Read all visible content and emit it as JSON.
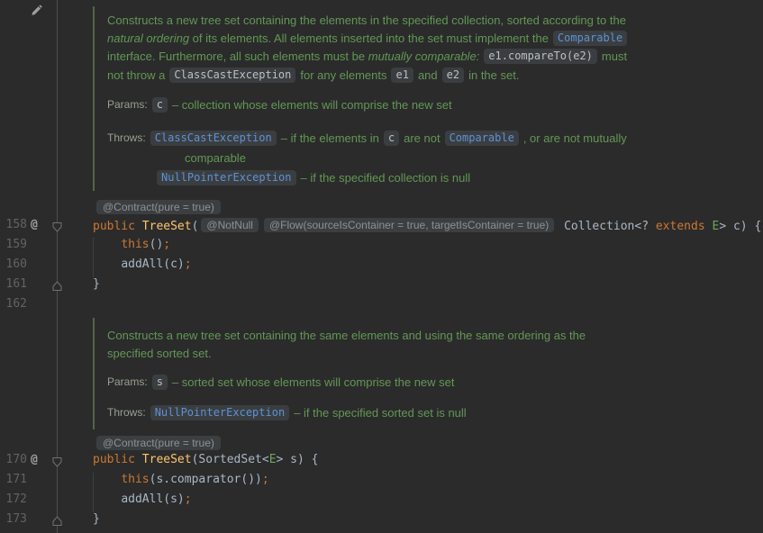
{
  "gutter": {
    "numbers": [
      "158",
      "159",
      "160",
      "161",
      "162",
      "170",
      "171",
      "172",
      "173"
    ],
    "annotation_symbol": "@"
  },
  "doc1": {
    "l1": "Constructs a new tree set containing the elements in the specified collection, sorted according to the",
    "l2_italic": "natural ordering",
    "l2_text": " of its elements. All elements inserted into the set must implement the",
    "l2_chip_link": "Comparable",
    "l3_text1": "interface. Furthermore, all such elements must be ",
    "l3_italic": "mutually comparable:",
    "l3_chip": "e1.compareTo(e2)",
    "l3_text2": "must",
    "l4_text1": "not throw a",
    "l4_chip1": "ClassCastException",
    "l4_text2": "for any elements",
    "l4_chip2": "e1",
    "l4_text3": "and",
    "l4_chip3": "e2",
    "l4_text4": "in the set.",
    "params_label": "Params:",
    "params_chip": "c",
    "params_text": "– collection whose elements will comprise the new set",
    "throws_label": "Throws:",
    "throws_chip1": "ClassCastException",
    "throws_text1": "– if the elements in",
    "throws_chip2": "c",
    "throws_text2": "are not",
    "throws_chip3": "Comparable",
    "throws_text3": ", or are not mutually",
    "throws_wrap": "comparable",
    "throws_chip4": "NullPointerException",
    "throws_text4": "– if the specified collection is null"
  },
  "code1": {
    "inlay_contract": "@Contract(pure = true)",
    "l158": {
      "kw1": "public ",
      "name": "TreeSet",
      "paren": "(",
      "inlay_notnull": "@NotNull",
      "inlay_flow": "@Flow(sourceIsContainer = true, targetIsContainer = true)",
      "t1": " Collection<? ",
      "kw2": "extends",
      "tp": " E",
      "t2": "> c) {"
    },
    "l159": {
      "indent": "    ",
      "kw": "this",
      "t": "()",
      "semi": ";"
    },
    "l160": {
      "indent": "    ",
      "t": "addAll(c)",
      "semi": ";"
    },
    "l161": {
      "t": "}"
    }
  },
  "doc2": {
    "l1": "Constructs a new tree set containing the same elements and using the same ordering as the",
    "l2": "specified sorted set.",
    "params_label": "Params:",
    "params_chip": "s",
    "params_text": "– sorted set whose elements will comprise the new set",
    "throws_label": "Throws:",
    "throws_chip": "NullPointerException",
    "throws_text": "– if the specified sorted set is null"
  },
  "code2": {
    "inlay_contract": "@Contract(pure = true)",
    "l170": {
      "kw1": "public ",
      "name": "TreeSet",
      "t1": "(SortedSet<",
      "tp": "E",
      "t2": "> s) {"
    },
    "l171": {
      "indent": "    ",
      "kw": "this",
      "t": "(s.comparator())",
      "semi": ";"
    },
    "l172": {
      "indent": "    ",
      "t": "addAll(s)",
      "semi": ";"
    },
    "l173": {
      "t": "}"
    }
  }
}
